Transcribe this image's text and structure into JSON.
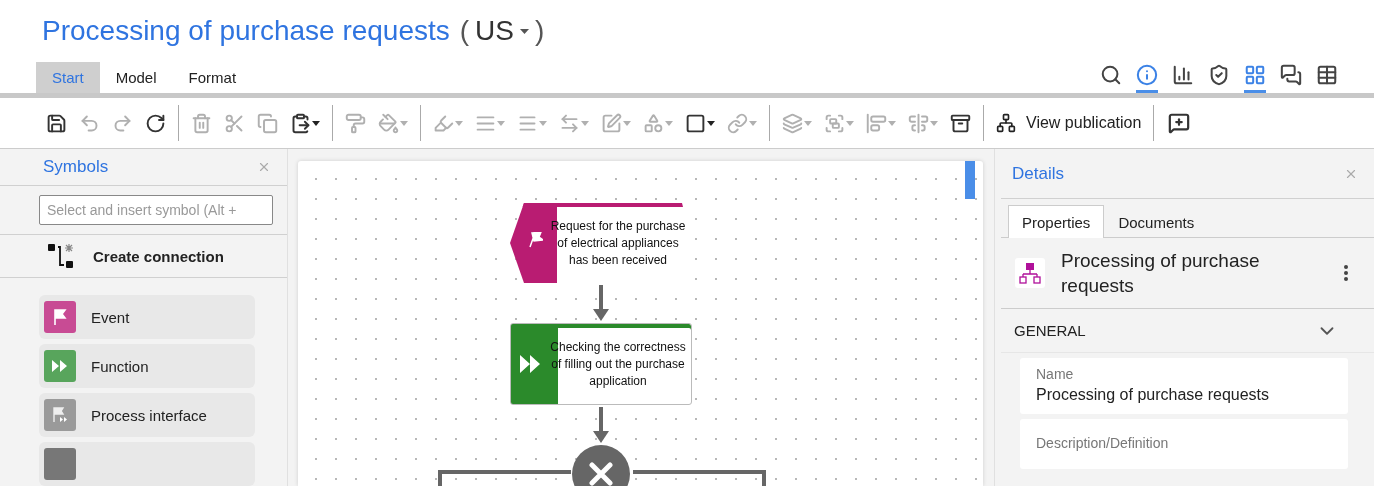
{
  "title": "Processing of purchase requests",
  "language": "US",
  "language_brackets": [
    "(",
    ")"
  ],
  "ribbon_tabs": [
    {
      "label": "Start",
      "selected": true
    },
    {
      "label": "Model",
      "selected": false
    },
    {
      "label": "Format",
      "selected": false
    }
  ],
  "view_buttons": [
    {
      "kind": "search",
      "selected": false
    },
    {
      "kind": "info",
      "selected": true
    },
    {
      "kind": "chart",
      "selected": false
    },
    {
      "kind": "shield",
      "selected": false
    },
    {
      "kind": "symbols",
      "selected": true
    },
    {
      "kind": "comments",
      "selected": false
    },
    {
      "kind": "table",
      "selected": false
    }
  ],
  "toolbar": [
    [
      {
        "kind": "save",
        "disabled": false,
        "dropdown": false
      },
      {
        "kind": "undo",
        "disabled": true,
        "dropdown": false
      },
      {
        "kind": "redo",
        "disabled": true,
        "dropdown": false
      },
      {
        "kind": "refresh",
        "disabled": false,
        "dropdown": false
      }
    ],
    [
      {
        "kind": "trash",
        "disabled": true,
        "dropdown": false
      },
      {
        "kind": "cut",
        "disabled": true,
        "dropdown": false
      },
      {
        "kind": "copy",
        "disabled": true,
        "dropdown": false
      },
      {
        "kind": "paste",
        "disabled": false,
        "dropdown": true
      }
    ],
    [
      {
        "kind": "format-painter",
        "disabled": true,
        "dropdown": false
      },
      {
        "kind": "fill",
        "disabled": true,
        "dropdown": true
      }
    ],
    [
      {
        "kind": "line-color",
        "disabled": true,
        "dropdown": true
      },
      {
        "kind": "line-style",
        "disabled": true,
        "dropdown": true
      },
      {
        "kind": "line-weight",
        "disabled": true,
        "dropdown": true
      },
      {
        "kind": "arrows",
        "disabled": true,
        "dropdown": true
      },
      {
        "kind": "edit",
        "disabled": true,
        "dropdown": true
      },
      {
        "kind": "replace",
        "disabled": true,
        "dropdown": true
      },
      {
        "kind": "shape",
        "disabled": false,
        "dropdown": true
      },
      {
        "kind": "link",
        "disabled": true,
        "dropdown": true
      }
    ],
    [
      {
        "kind": "arrange",
        "disabled": true,
        "dropdown": true
      },
      {
        "kind": "group",
        "disabled": true,
        "dropdown": true
      },
      {
        "kind": "align",
        "disabled": true,
        "dropdown": true
      },
      {
        "kind": "distribute",
        "disabled": true,
        "dropdown": true
      },
      {
        "kind": "cabinet",
        "disabled": false,
        "dropdown": false
      }
    ]
  ],
  "publication_button": {
    "label": "View publication"
  },
  "symbols_panel": {
    "title": "Symbols",
    "search": {
      "placeholder": "Select and insert symbol (Alt +"
    },
    "create_connection": "Create connection",
    "symbols": [
      {
        "kind": "event",
        "label": "Event"
      },
      {
        "kind": "function",
        "label": "Function"
      },
      {
        "kind": "process-interface",
        "label": "Process interface"
      },
      {
        "kind": "generic"
      }
    ]
  },
  "diagram": {
    "nodes": [
      {
        "kind": "event",
        "label": "Request for the purchase of electrical appliances has been received"
      },
      {
        "kind": "function",
        "label": "Checking the correctness of filling out the purchase application"
      },
      {
        "kind": "xor"
      }
    ]
  },
  "details_panel": {
    "title": "Details",
    "tabs": [
      {
        "label": "Properties",
        "selected": true
      },
      {
        "label": "Documents",
        "selected": false
      }
    ],
    "object_name": "Processing of purchase requests",
    "section": {
      "title": "GENERAL",
      "expanded": true
    },
    "fields": [
      {
        "label": "Name",
        "value": "Processing of purchase requests"
      },
      {
        "label": "Description/Definition"
      }
    ]
  }
}
